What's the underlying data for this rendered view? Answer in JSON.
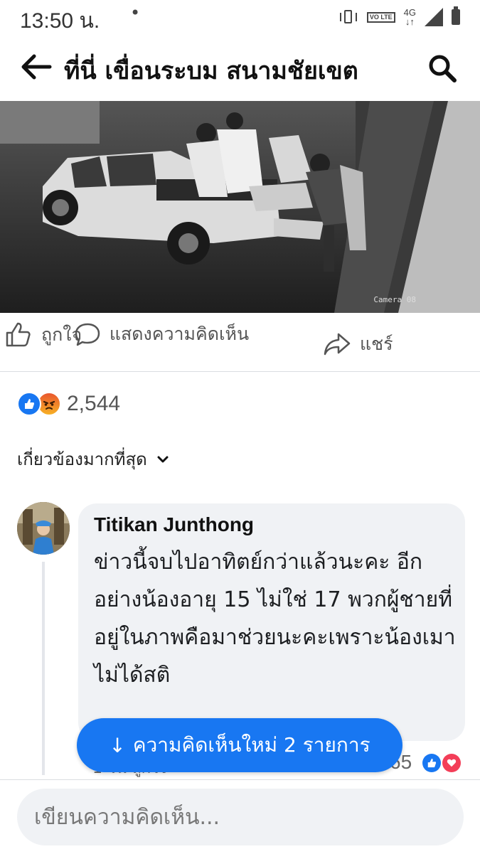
{
  "status_bar": {
    "time": "13:50 น.",
    "dot": "•",
    "volte_label": "VO LTE",
    "network_label": "4G",
    "icons": [
      "vibrate-icon",
      "volte-icon",
      "4g-icon",
      "signal-icon",
      "battery-icon"
    ]
  },
  "header": {
    "title": "ที่นี่ เขื่อนระบม สนามชัยเขต",
    "icons": [
      "back-arrow-icon",
      "search-icon"
    ]
  },
  "post": {
    "camera_label": "Camera 08"
  },
  "actions": {
    "like_label": "ถูกใจ",
    "comment_label": "แสดงความคิดเห็น",
    "share_label": "แชร์"
  },
  "reactions": {
    "count": "2,544",
    "types": [
      "like",
      "angry"
    ]
  },
  "sort": {
    "label": "เกี่ยวข้องมากที่สุด"
  },
  "comment": {
    "author": "Titikan Junthong",
    "text": "ข่าวนี้จบไปอาทิตย์กว่าแล้วนะคะ อีกอย่างน้องอายุ 15 ไม่ใช่ 17 พวกผู้ชายที่อยู่ในภาพคือมาช่วยนะคะเพราะน้องเมาไม่ได้สติ",
    "meta": "1 วัน  ถูกใจ",
    "reaction_count": "65",
    "reaction_types": [
      "like",
      "love"
    ]
  },
  "new_comments": {
    "arrow": "↓",
    "label": "ความคิดเห็นใหม่ 2 รายการ"
  },
  "composer": {
    "placeholder": "เขียนความคิดเห็น..."
  },
  "colors": {
    "accent": "#1877f2",
    "bubble": "#f0f2f5",
    "love": "#f33e58"
  }
}
